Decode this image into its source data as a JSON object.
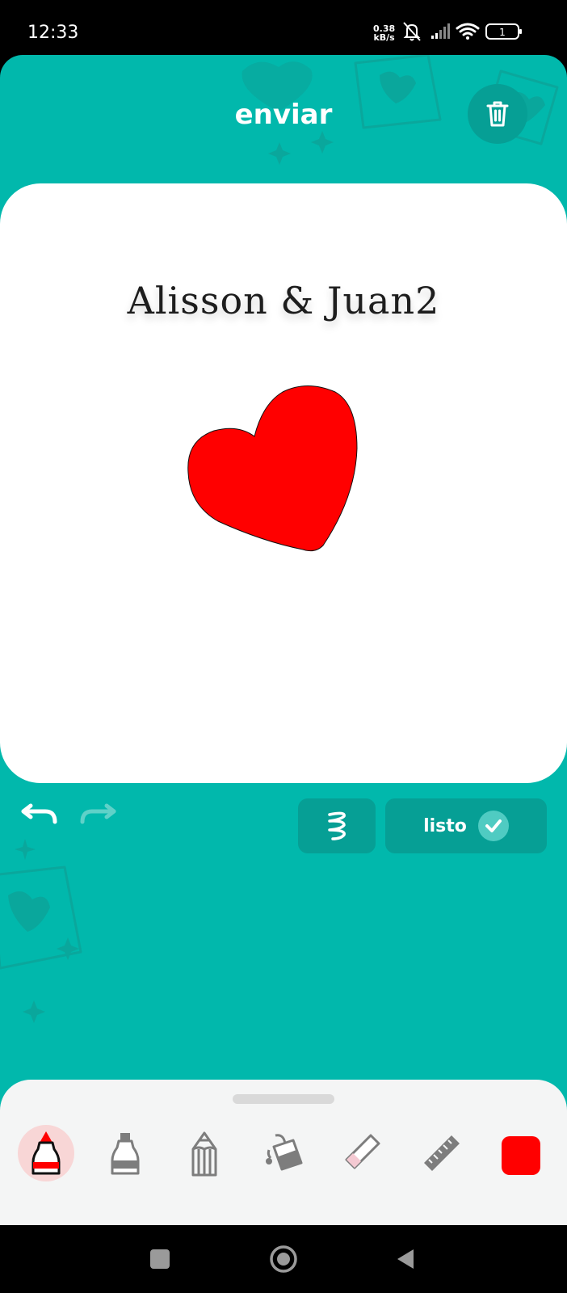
{
  "status_bar": {
    "time": "12:33",
    "net_speed_value": "0.38",
    "net_speed_unit": "kB/s",
    "battery_level": "1"
  },
  "header": {
    "title": "enviar",
    "trash_icon": "trash-icon"
  },
  "canvas": {
    "caption": "Alisson & Juan2",
    "drawing": "heart",
    "drawing_color": "#ff0000"
  },
  "actions": {
    "undo_icon": "undo-icon",
    "redo_icon": "redo-icon",
    "smoothing_icon": "scribble-icon",
    "done_label": "listo"
  },
  "tools": {
    "items": [
      {
        "name": "marker",
        "icon": "marker-icon",
        "active": true
      },
      {
        "name": "bottle",
        "icon": "paint-bottle-icon",
        "active": false
      },
      {
        "name": "pencil",
        "icon": "pencil-icon",
        "active": false
      },
      {
        "name": "fill",
        "icon": "paint-bucket-icon",
        "active": false
      },
      {
        "name": "eraser",
        "icon": "eraser-icon",
        "active": false
      },
      {
        "name": "ruler",
        "icon": "ruler-icon",
        "active": false
      }
    ],
    "selected_color": "#ff0000"
  },
  "colors": {
    "background": "#01b8ac",
    "button": "#069f95",
    "accent": "#ff0000"
  }
}
